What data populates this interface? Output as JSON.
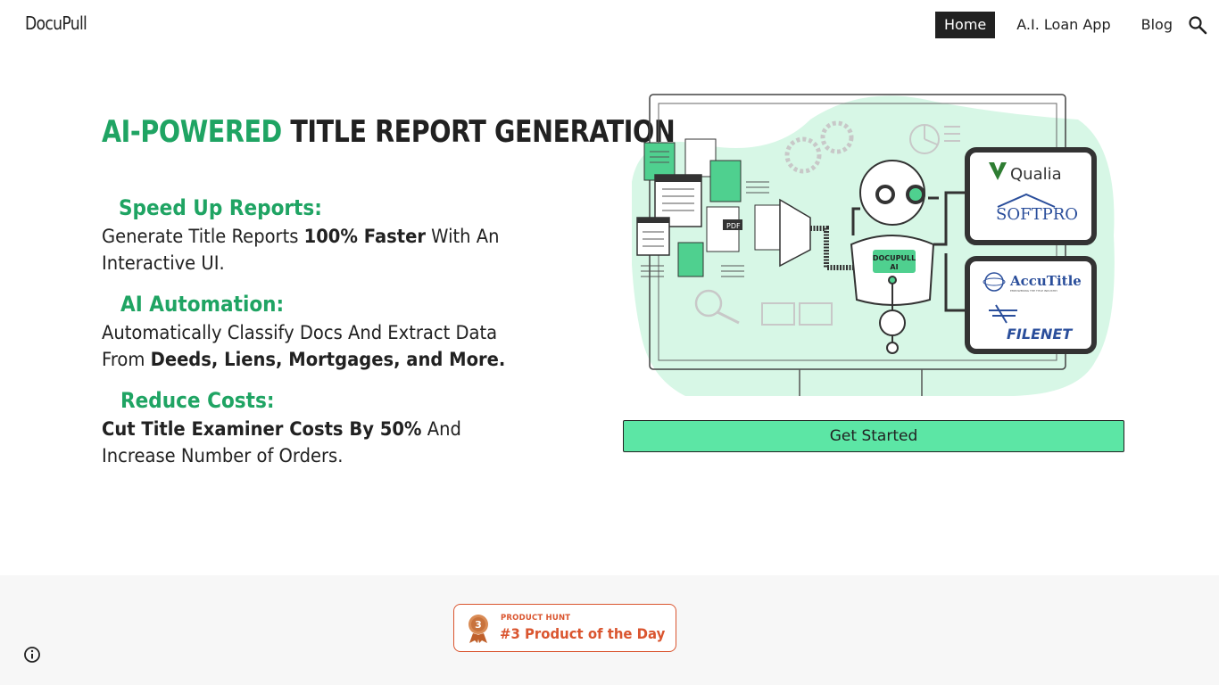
{
  "header": {
    "logo": "DocuPull",
    "nav": [
      {
        "label": "Home",
        "active": true
      },
      {
        "label": "A.I. Loan App",
        "active": false
      },
      {
        "label": "Blog",
        "active": false
      }
    ],
    "search_icon": "search-icon"
  },
  "hero": {
    "title_accent": "AI-POWERED",
    "title_rest": " TITLE REPORT GENERATION"
  },
  "features": [
    {
      "heading": "Speed Up Reports:",
      "parts": [
        "Generate Title Reports ",
        "100% Faster",
        " With An Interactive UI."
      ]
    },
    {
      "heading": "AI Automation:",
      "parts": [
        "Automatically Classify Docs And Extract Data From ",
        "Deeds, Liens, Mortgages, and More."
      ]
    },
    {
      "heading": "Reduce Costs:",
      "parts": [
        "Cut Title Examiner Costs By 50%",
        " And Increase Number of Orders."
      ]
    }
  ],
  "illustration": {
    "robot_label_1": "DOCUPULL",
    "robot_label_2": "AI",
    "pdf_label": "PDF",
    "partners": [
      "Qualia",
      "SOFTPRO",
      "AccuTitle",
      "EMPOWERING THE TITLE INDUSTRY",
      "FILENET"
    ]
  },
  "cta": {
    "label": "Get Started"
  },
  "footer": {
    "badge_small": "PRODUCT HUNT",
    "badge_big": "#3 Product of the Day",
    "badge_rank": "3",
    "info_icon": "info-icon"
  },
  "colors": {
    "accent": "#1fa463",
    "button": "#5ce6a5",
    "product_hunt": "#da552f",
    "illustration_blob": "#d7f7e6"
  }
}
